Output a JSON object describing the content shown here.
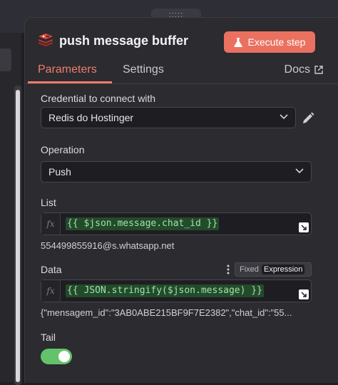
{
  "node": {
    "title": "push message buffer",
    "execute_label": "Execute step"
  },
  "tabs": {
    "parameters": "Parameters",
    "settings": "Settings",
    "docs": "Docs"
  },
  "credential": {
    "label": "Credential to connect with",
    "value": "Redis do Hostinger"
  },
  "operation": {
    "label": "Operation",
    "value": "Push"
  },
  "list": {
    "label": "List",
    "expression": "{{ $json.message.chat_id }}",
    "result": "554499855916@s.whatsapp.net"
  },
  "data": {
    "label": "Data",
    "mode_fixed": "Fixed",
    "mode_expression": "Expression",
    "expression": "{{ JSON.stringify($json.message) }}",
    "result": "{\"mensagem_id\":\"3AB0ABE215BF9F7E2382\",\"chat_id\":\"55..."
  },
  "tail": {
    "label": "Tail",
    "enabled": true
  },
  "colors": {
    "accent": "#ea7160",
    "toggle_on": "#63c36b",
    "code_text": "#9fe3a7"
  },
  "icons": {
    "node": "redis-icon",
    "execute": "flask-icon",
    "docs": "external-link-icon",
    "edit": "pencil-icon",
    "dropdown": "chevron-down-icon",
    "expand": "expand-icon",
    "more": "kebab-menu-icon"
  }
}
